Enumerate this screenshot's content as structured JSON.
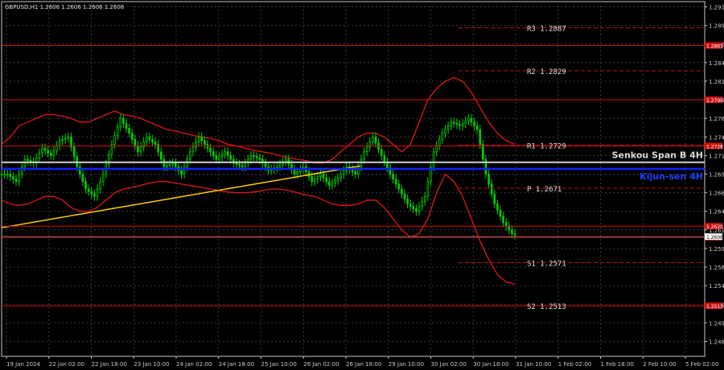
{
  "header": {
    "title": "GBPUSD,H1  1.2606 1.2606 1.2606 1.2608"
  },
  "chart_data": {
    "type": "candlestick",
    "symbol": "GBPUSD",
    "timeframe": "H1",
    "ohlc_header": [
      1.2606,
      1.2606,
      1.2606,
      1.2608
    ],
    "ylim": [
      1.2445,
      1.2922
    ],
    "y_ticks": [
      1.2465,
      1.249,
      1.2515,
      1.254,
      1.2565,
      1.259,
      1.2615,
      1.264,
      1.2665,
      1.269,
      1.2715,
      1.274,
      1.2765,
      1.279,
      1.2815,
      1.284,
      1.2865,
      1.289,
      1.2915
    ],
    "y_tick_labels": [
      "1.2465",
      "1.2490",
      "1.2515",
      "1.2540",
      "1.2565",
      "1.2590",
      "1.2615",
      "1.2640",
      "1.2665",
      "1.2690",
      "1.2715",
      "1.2740",
      "1.2765",
      "1.2790",
      "1.2815",
      "1.2840",
      "1.2865",
      "1.2890",
      "1.2915"
    ],
    "x_tick_labels": [
      "19 Jan 2024",
      "22 Jan 02:00",
      "22 Jan 18:00",
      "23 Jan 10:00",
      "24 Jan 02:00",
      "24 Jan 18:00",
      "25 Jan 10:00",
      "26 Jan 02:00",
      "26 Jan 18:00",
      "29 Jan 10:00",
      "30 Jan 02:00",
      "30 Jan 18:00",
      "31 Jan 10:00",
      "1 Feb 02:00",
      "1 Feb 18:00",
      "2 Feb 10:00",
      "5 Feb 02:00"
    ],
    "pivot_levels": [
      {
        "label": "R3 1.2887",
        "value": 1.2887
      },
      {
        "label": "R2 1.2829",
        "value": 1.2829
      },
      {
        "label": "R1 1.2729",
        "value": 1.2729
      },
      {
        "label": "P 1.2671",
        "value": 1.2671
      },
      {
        "label": "S1 1.2571",
        "value": 1.2571
      },
      {
        "label": "S2 1.2513",
        "value": 1.2513
      }
    ],
    "resistance_lines": [
      1.2863,
      1.279,
      1.2728,
      1.262,
      1.2605,
      1.2513
    ],
    "resistance_labels": [
      "1.2863",
      "1.2790",
      "1.2728",
      "1.2620",
      "1.2605",
      "1.2513"
    ],
    "indicators": {
      "senkou_span_b": {
        "name": "Senkou Span B 4H",
        "value": 1.2706
      },
      "kijun_sen": {
        "name": "Kijun-sen 4H",
        "value": 1.2697
      }
    },
    "current_price": {
      "label": "1.2606",
      "value": 1.2606
    },
    "trendline": {
      "from": [
        0,
        1.2618
      ],
      "to": [
        0.51,
        1.2701
      ]
    },
    "price_path": [
      1.269,
      1.268,
      1.271,
      1.2705,
      1.2725,
      1.2715,
      1.2735,
      1.274,
      1.27,
      1.267,
      1.266,
      1.269,
      1.273,
      1.2765,
      1.2745,
      1.272,
      1.274,
      1.273,
      1.27,
      1.2705,
      1.269,
      1.272,
      1.274,
      1.2725,
      1.271,
      1.272,
      1.2705,
      1.27,
      1.2715,
      1.271,
      1.2695,
      1.27,
      1.271,
      1.269,
      1.27,
      1.268,
      1.269,
      1.2675,
      1.2685,
      1.27,
      1.269,
      1.272,
      1.274,
      1.2715,
      1.269,
      1.267,
      1.265,
      1.264,
      1.266,
      1.272,
      1.2745,
      1.276,
      1.2755,
      1.2765,
      1.275,
      1.269,
      1.265,
      1.2625,
      1.261,
      1.2606
    ],
    "bollinger_upper": [
      1.273,
      1.274,
      1.2755,
      1.276,
      1.2765,
      1.277,
      1.277,
      1.2768,
      1.2765,
      1.276,
      1.276,
      1.2765,
      1.277,
      1.2775,
      1.277,
      1.2768,
      1.2765,
      1.276,
      1.2755,
      1.275,
      1.2748,
      1.2745,
      1.2742,
      1.274,
      1.2738,
      1.2735,
      1.273,
      1.2728,
      1.2725,
      1.2722,
      1.272,
      1.2718,
      1.2715,
      1.2712,
      1.271,
      1.2708,
      1.2705,
      1.2705,
      1.271,
      1.272,
      1.273,
      1.274,
      1.2745,
      1.2745,
      1.274,
      1.273,
      1.272,
      1.273,
      1.276,
      1.279,
      1.2805,
      1.2815,
      1.282,
      1.2815,
      1.28,
      1.278,
      1.276,
      1.2745,
      1.2735,
      1.273
    ],
    "bollinger_lower": [
      1.2655,
      1.265,
      1.2648,
      1.265,
      1.2655,
      1.266,
      1.266,
      1.2655,
      1.2645,
      1.264,
      1.264,
      1.2645,
      1.2655,
      1.2665,
      1.267,
      1.2672,
      1.2675,
      1.2678,
      1.268,
      1.268,
      1.2678,
      1.2676,
      1.2674,
      1.2672,
      1.267,
      1.2668,
      1.2666,
      1.2665,
      1.2665,
      1.2666,
      1.2668,
      1.267,
      1.267,
      1.2668,
      1.2665,
      1.2662,
      1.266,
      1.2655,
      1.265,
      1.2648,
      1.2648,
      1.265,
      1.2655,
      1.2655,
      1.2645,
      1.263,
      1.2615,
      1.2605,
      1.261,
      1.263,
      1.2665,
      1.269,
      1.268,
      1.266,
      1.263,
      1.26,
      1.2575,
      1.2555,
      1.2545,
      1.2542
    ]
  }
}
